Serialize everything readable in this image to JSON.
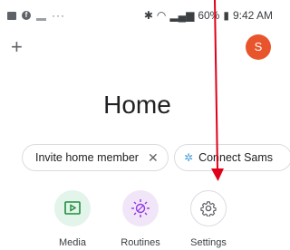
{
  "status_bar": {
    "left_dots": "···",
    "battery": "60%",
    "time": "9:42 AM"
  },
  "header": {
    "add_icon": "plus-icon",
    "avatar_initial": "S"
  },
  "title": "Home",
  "chips": [
    {
      "label": "Invite home member",
      "close": "✕"
    },
    {
      "label": "Connect Sams"
    }
  ],
  "actions": [
    {
      "label": "Media",
      "icon": "media-icon",
      "color": "#e3f4ea"
    },
    {
      "label": "Routines",
      "icon": "routines-icon",
      "color": "#f1e6f8"
    },
    {
      "label": "Settings",
      "icon": "gear-icon",
      "color": "#ffffff"
    }
  ],
  "annotation_color": "#e0001a"
}
